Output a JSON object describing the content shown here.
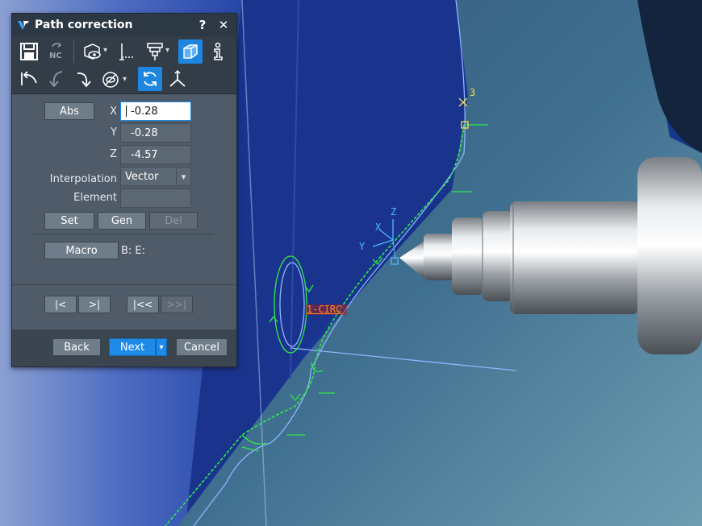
{
  "dialog": {
    "title": "Path correction",
    "help_label": "?",
    "close_label": "✕",
    "nc_label": "NC",
    "abs_label": "Abs",
    "x_label": "X",
    "y_label": "Y",
    "z_label": "Z",
    "x_value": "-0.28",
    "y_value": "-0.28",
    "z_value": "-4.57",
    "interpolation_label": "Interpolation",
    "interpolation_value": "Vector",
    "element_label": "Element",
    "element_value": "",
    "set_label": "Set",
    "gen_label": "Gen",
    "del_label": "Del",
    "macro_label": "Macro",
    "macro_info": "B: E:",
    "nav_first_label": "|<",
    "nav_last_label": ">|",
    "nav_prev_fast_label": "|<<",
    "nav_next_fast_label": ">>|",
    "back_label": "Back",
    "next_label": "Next",
    "cancel_label": "Cancel"
  },
  "viewport": {
    "point_label": "3",
    "axis_x": "X",
    "axis_y": "Y",
    "axis_z": "Z",
    "circle_label": "1-CIRC"
  },
  "colors": {
    "accent": "#1e8ae8",
    "path_green": "#2ee84a",
    "path_blue": "#8fb5ff",
    "label_orange": "#ff8a1e",
    "point_yellow": "#f0e04a"
  },
  "icons": {
    "save": "floppy-icon",
    "nc": "nc-icon",
    "view": "eye-cube-icon",
    "measure": "dimension-icon",
    "tool": "tool-holder-icon",
    "cube": "cube-icon",
    "info": "info-icon",
    "undo": "undo-arrow-icon",
    "step_back": "curved-down-arrow-icon",
    "step_forward": "curved-forward-arrow-icon",
    "eye_disabled": "eye-crossed-icon",
    "refresh": "refresh-icon",
    "axes": "axes-icon"
  }
}
